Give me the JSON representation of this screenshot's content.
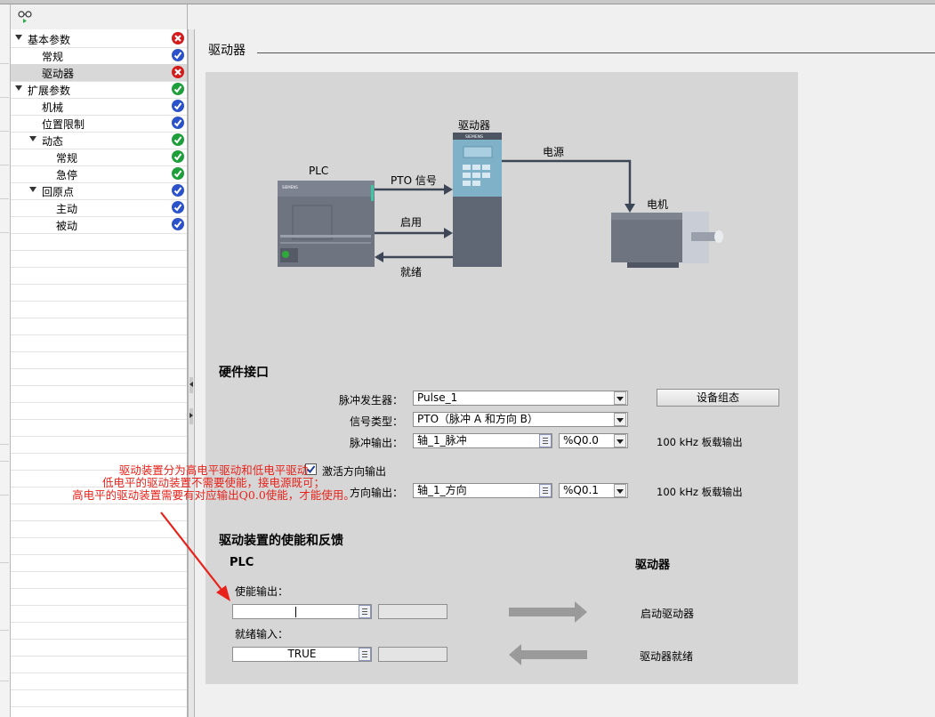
{
  "tree": {
    "items": [
      {
        "label": "基本参数",
        "status": "error"
      },
      {
        "label": "常规",
        "status": "blue"
      },
      {
        "label": "驱动器",
        "status": "error"
      },
      {
        "label": "扩展参数",
        "status": "ok"
      },
      {
        "label": "机械",
        "status": "blue"
      },
      {
        "label": "位置限制",
        "status": "blue"
      },
      {
        "label": "动态",
        "status": "ok"
      },
      {
        "label": "常规",
        "status": "ok"
      },
      {
        "label": "急停",
        "status": "ok"
      },
      {
        "label": "回原点",
        "status": "blue"
      },
      {
        "label": "主动",
        "status": "blue"
      },
      {
        "label": "被动",
        "status": "blue"
      }
    ]
  },
  "section_title": "驱动器",
  "diagram": {
    "plc_label": "PLC",
    "drive_label": "驱动器",
    "motor_label": "电机",
    "power_label": "电源",
    "pto_label": "PTO 信号",
    "enable_label": "启用",
    "ready_label": "就绪",
    "brand": "SIEMENS"
  },
  "hardware": {
    "heading": "硬件接口",
    "pulse_gen_label": "脉冲发生器：",
    "pulse_gen_value": "Pulse_1",
    "device_config_button": "设备组态",
    "signal_type_label": "信号类型：",
    "signal_type_value": "PTO（脉冲 A 和方向 B）",
    "pulse_out_label": "脉冲输出：",
    "pulse_out_value": "轴_1_脉冲",
    "pulse_out_addr": "%Q0.0",
    "pulse_out_note": "100 kHz 板载输出",
    "activate_dir_label": "激活方向输出",
    "activate_dir_checked": true,
    "dir_out_label": "方向输出：",
    "dir_out_value": "轴_1_方向",
    "dir_out_addr": "%Q0.1",
    "dir_out_note": "100 kHz 板载输出"
  },
  "enable": {
    "heading": "驱动装置的使能和反馈",
    "plc_col": "PLC",
    "drive_col": "驱动器",
    "enable_out_label": "使能输出：",
    "enable_out_value": "",
    "start_drive_label": "启动驱动器",
    "ready_in_label": "就绪输入：",
    "ready_in_value": "TRUE",
    "drive_ready_label": "驱动器就绪"
  },
  "annotation": {
    "line1": "驱动装置分为高电平驱动和低电平驱动",
    "line2": "低电平的驱动装置不需要使能，接电源既可；",
    "line3": "高电平的驱动装置需要有对应输出Q0.0使能，才能使用。",
    "color": "#e8221a"
  },
  "icons": {
    "status_error": "error-x-icon",
    "status_ok": "checkmark-icon"
  }
}
